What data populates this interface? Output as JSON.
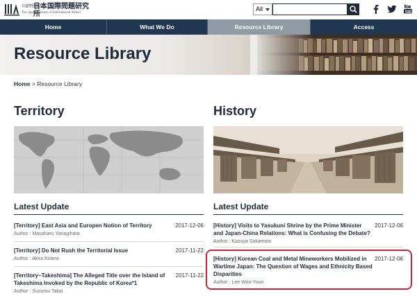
{
  "header": {
    "logo_mark": "JIIA",
    "logo_small": "公益財団法人",
    "logo_name": "日本国際問題研究所",
    "logo_en": "The Japan Institute of International Affairs"
  },
  "search": {
    "scope": "All",
    "value": "",
    "placeholder": ""
  },
  "icons": {
    "search": "search-icon",
    "facebook": "facebook-icon",
    "twitter": "twitter-icon",
    "youtube": "youtube-icon"
  },
  "colors": {
    "navy": "#1f3750",
    "active_tab": "#8f9aa5",
    "highlight": "#c3263a"
  },
  "nav": {
    "items": [
      {
        "label": "Home"
      },
      {
        "label": "What We Do"
      },
      {
        "label": "Resource Library",
        "active": true
      },
      {
        "label": "Access"
      }
    ]
  },
  "hero": {
    "title": "Resource Library"
  },
  "breadcrumb": {
    "home": "Home",
    "separator": ">",
    "current": "Resource Library"
  },
  "territory": {
    "title": "Territory",
    "subtitle": "Latest Update",
    "entries": [
      {
        "title": "[Territory] East Asia and Europen Notion of Territory",
        "date": "2017-12-06",
        "author": "Author : Masaharu Yanagihara"
      },
      {
        "title": "[Territory] Do Not Rush the Territorial Issue",
        "date": "2017-11-22",
        "author": "Author : Akira Kotera"
      },
      {
        "title_line1": "[Territory~Takeshima] The Alleged Title over the Island of",
        "title_line2": "Takeshima Invoked by the Republic of Korea*1",
        "date": "2017-11-22",
        "author": "Author : Susumu Takai"
      }
    ]
  },
  "history": {
    "title": "History",
    "subtitle": "Latest Update",
    "entries": [
      {
        "title_line1": "[History] Visits to Yasukuni Shrine by the Prime Minister",
        "title_line2": "and Japan-China Relations: What is Confusing the Debate?",
        "date": "2017-12-06",
        "author": "Author : Kazuya Sakamoto"
      },
      {
        "title_line1": "[History] Korean Coal and Metal Mineworkers Mobilized in",
        "title_line2": "Wartime Japan: The Question of Wages and Ethnicity Based",
        "title_line3": "Disparities",
        "date": "2017-12-06",
        "author": "Author : Lee Woo-Youn"
      }
    ]
  }
}
